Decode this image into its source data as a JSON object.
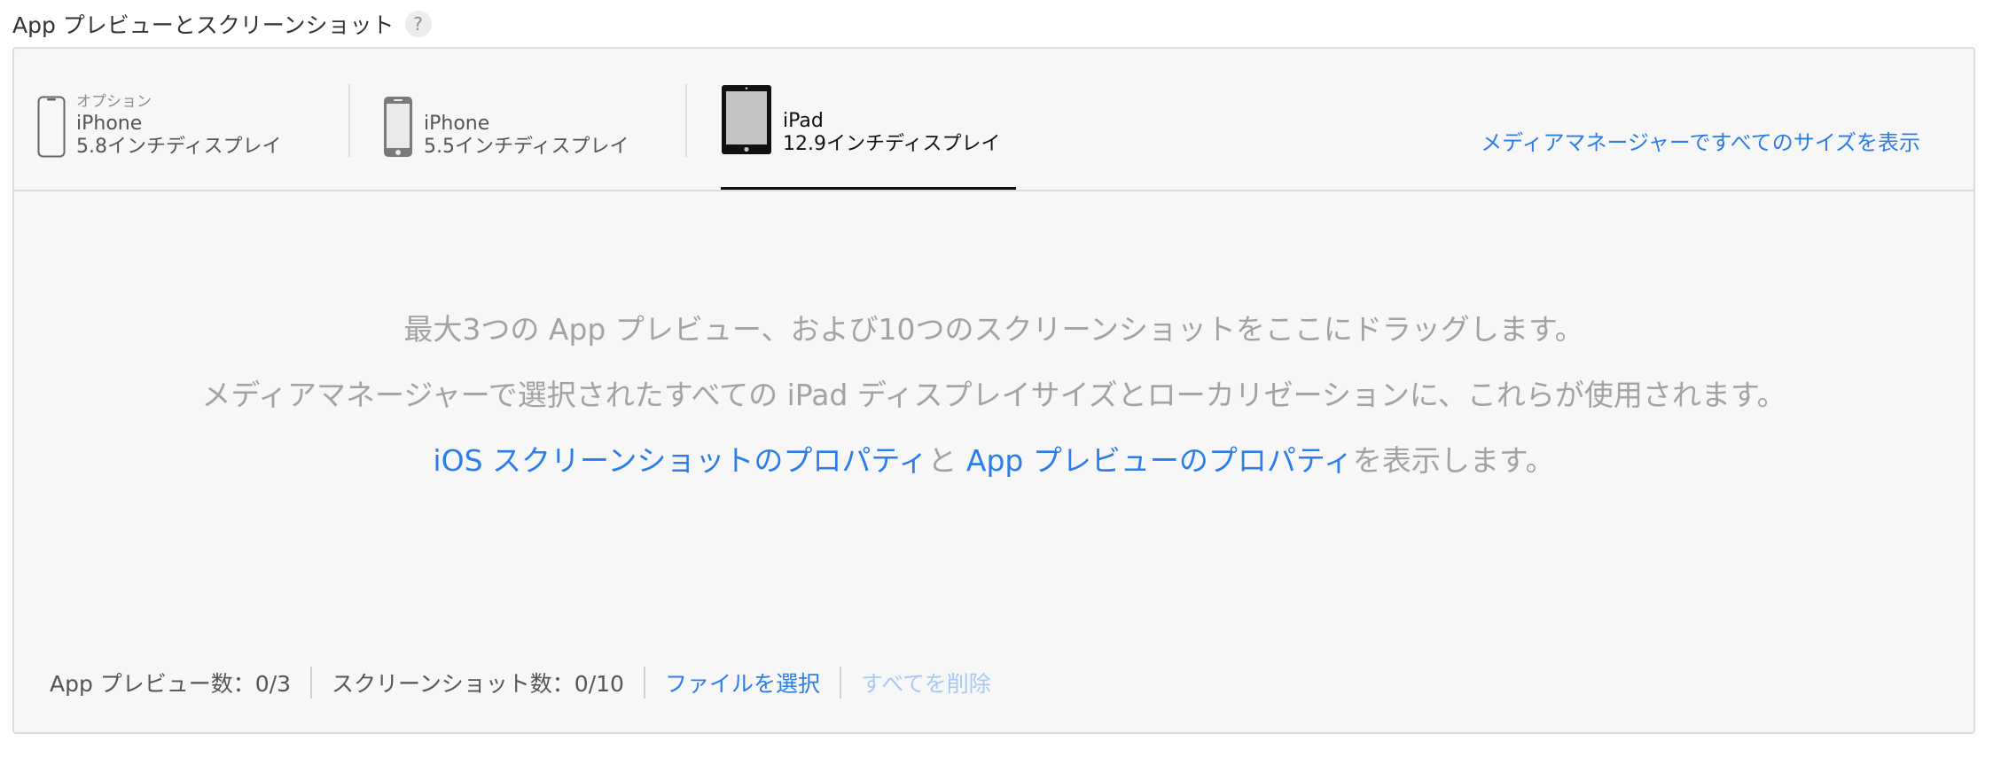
{
  "section": {
    "title": "App プレビューとスクリーンショット",
    "help": "?"
  },
  "tabs": [
    {
      "optional": "オプション",
      "model": "iPhone",
      "size": "5.8インチディスプレイ",
      "icon": "iphone-notch-icon",
      "active": false
    },
    {
      "optional": "",
      "model": "iPhone",
      "size": "5.5インチディスプレイ",
      "icon": "iphone-home-button-icon",
      "active": false
    },
    {
      "optional": "",
      "model": "iPad",
      "size": "12.9インチディスプレイ",
      "icon": "ipad-icon",
      "active": true
    }
  ],
  "media_manager_link": "メディアマネージャーですべてのサイズを表示",
  "drop": {
    "line1": "最大3つの App プレビュー、および10つのスクリーンショットをここにドラッグします。",
    "line2": "メディアマネージャーで選択されたすべての iPad ディスプレイサイズとローカリゼーションに、これらが使用されます。",
    "link_screenshot_props": "iOS スクリーンショットのプロパティ",
    "and": "と",
    "link_preview_props": "App プレビューのプロパティ",
    "line3_tail": "を表示します。"
  },
  "footer": {
    "preview_count": "App プレビュー数：0/3",
    "screenshot_count": "スクリーンショット数：0/10",
    "choose_file": "ファイルを選択",
    "delete_all": "すべてを削除"
  },
  "colors": {
    "link": "#2b7de9",
    "link_disabled": "#a9c9f2",
    "panel_bg": "#f7f7f7"
  }
}
